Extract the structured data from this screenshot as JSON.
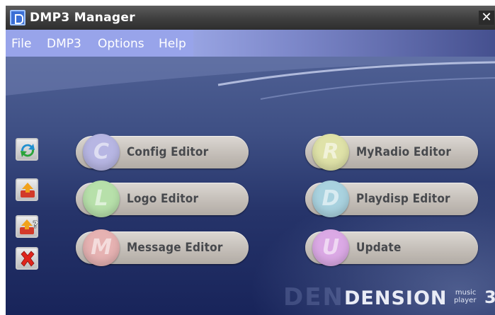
{
  "window": {
    "title": "DMP3 Manager",
    "close_glyph": "✕"
  },
  "menu": {
    "items": [
      "File",
      "DMP3",
      "Options",
      "Help"
    ]
  },
  "side_buttons": [
    {
      "name": "refresh-icon"
    },
    {
      "name": "send-icon"
    },
    {
      "name": "help-icon"
    },
    {
      "name": "close-x-icon"
    }
  ],
  "editors": [
    {
      "letter": "C",
      "label": "Config Editor",
      "color": "#b7b6e3"
    },
    {
      "letter": "R",
      "label": "MyRadio Editor",
      "color": "#dfe2a8"
    },
    {
      "letter": "L",
      "label": "Logo Editor",
      "color": "#b7e0aa"
    },
    {
      "letter": "D",
      "label": "Playdisp Editor",
      "color": "#a9d2df"
    },
    {
      "letter": "M",
      "label": "Message Editor",
      "color": "#e6b2b2"
    },
    {
      "letter": "U",
      "label": "Update",
      "color": "#dba9e5"
    }
  ],
  "brand": {
    "word": "DENSION",
    "small_top": "music",
    "small_bottom": "player",
    "number": "3",
    "ghost": "DEN"
  }
}
